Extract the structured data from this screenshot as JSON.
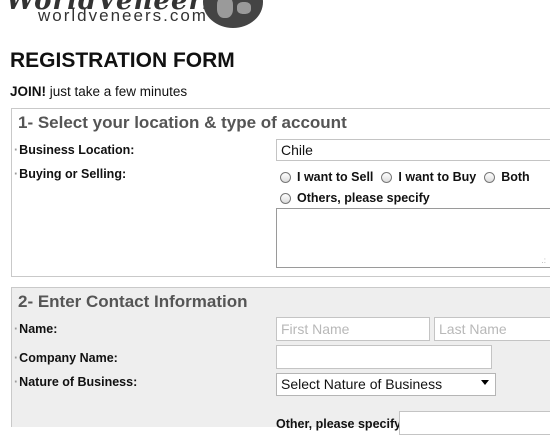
{
  "brand": {
    "script_text": "WorldVeneers",
    "url_text": "worldveneers.com"
  },
  "page_title": "REGISTRATION FORM",
  "tagline": {
    "join": "JOIN!",
    "rest": " just take a few minutes"
  },
  "section1": {
    "heading": "1- Select your location & type of account",
    "business_location_label": "Business Location:",
    "business_location_value": "Chile",
    "buying_selling_label": "Buying or Selling:",
    "options": [
      "I want to Sell",
      "I want to Buy",
      "Both",
      "Others, please specify"
    ]
  },
  "section2": {
    "heading": "2- Enter Contact Information",
    "name_label": "Name:",
    "first_name_placeholder": "First Name",
    "last_name_placeholder": "Last Name",
    "company_label": "Company Name:",
    "nature_label": "Nature of Business:",
    "nature_selected": "Select Nature of Business",
    "other_label": "Other, please specify"
  }
}
